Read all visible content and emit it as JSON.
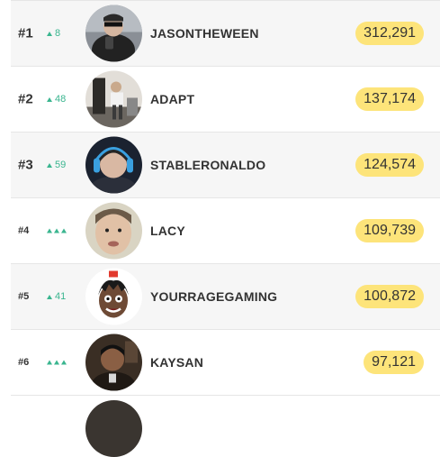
{
  "leaderboard": {
    "rows": [
      {
        "rank": "#1",
        "change": "8",
        "change_icon": "triangle-up",
        "name": "JASONTHEWEEN",
        "score": "312,291"
      },
      {
        "rank": "#2",
        "change": "48",
        "change_icon": "triangle-up",
        "name": "ADAPT",
        "score": "137,174"
      },
      {
        "rank": "#3",
        "change": "59",
        "change_icon": "triangle-up",
        "name": "STABLERONALDO",
        "score": "124,574"
      },
      {
        "rank": "#4",
        "change": "",
        "change_icon": "triple-triangle-up",
        "name": "LACY",
        "score": "109,739"
      },
      {
        "rank": "#5",
        "change": "41",
        "change_icon": "triangle-up",
        "name": "YOURRAGEGAMING",
        "score": "100,872"
      },
      {
        "rank": "#6",
        "change": "",
        "change_icon": "triple-triangle-up",
        "name": "KAYSAN",
        "score": "97,121"
      }
    ]
  },
  "colors": {
    "score_badge": "#fde47a",
    "rank_up": "#3ab58f",
    "row_shade": "#f6f6f6"
  }
}
